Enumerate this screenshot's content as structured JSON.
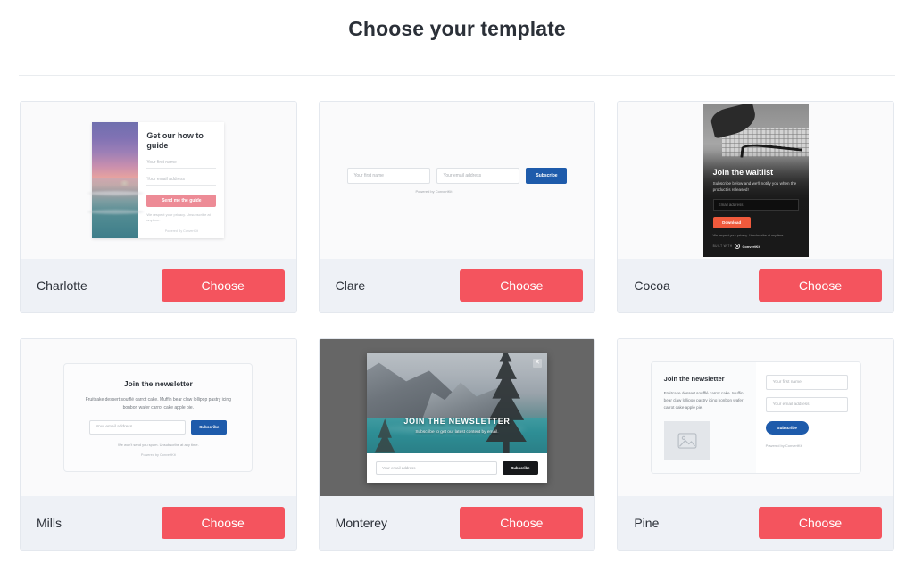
{
  "header": {
    "title": "Choose your template"
  },
  "common": {
    "choose_label": "Choose",
    "powered_by": "Powered by ConvertKit",
    "powered_by_cap": "Powered By ConvertKit",
    "built_with": "BUILT WITH",
    "convertkit": "ConvertKit",
    "placeholder_first_name": "Your first name",
    "placeholder_email": "Your email address",
    "subscribe_label": "Subscribe",
    "close_icon": "✕"
  },
  "colors": {
    "choose_button": "#f4545e",
    "footer_band": "#eef1f6",
    "preview_bg": "#fafafb",
    "card_border": "#e4e8ee",
    "blue_button": "#1e5bab",
    "orange_button": "#f05a3c",
    "pink_button": "#ed8b96",
    "dark_button": "#16181a",
    "title_text": "#2b3038"
  },
  "templates": [
    {
      "id": "charlotte",
      "name": "Charlotte",
      "preview": {
        "heading": "Get our how to guide",
        "first_name": "Your first name",
        "email": "Your email address",
        "button": "Send me the guide",
        "fine_print": "We respect your privacy. Unsubscribe at anytime.",
        "powered_by": "Powered By ConvertKit",
        "image_alt": "sunset-over-ocean-photo"
      }
    },
    {
      "id": "clare",
      "name": "Clare",
      "preview": {
        "first_name": "Your first name",
        "email": "Your email address",
        "button": "Subscribe",
        "powered_by": "Powered by ConvertKit"
      }
    },
    {
      "id": "cocoa",
      "name": "Cocoa",
      "preview": {
        "heading": "Join the waitlist",
        "subheading": "Subscribe below and we'll notify you when the product is released!",
        "email": "Email address",
        "button": "Download",
        "fine_print": "We respect your privacy. Unsubscribe at any time.",
        "built_with": "BUILT WITH",
        "convertkit": "ConvertKit",
        "image_alt": "grayscale-bicycle-city-photo"
      }
    },
    {
      "id": "mills",
      "name": "Mills",
      "preview": {
        "heading": "Join the newsletter",
        "body": "Fruitcake dessert soufflé carrot cake. Muffin bear claw lollipop pastry icing bonbon wafer carrot cake apple pie.",
        "email": "Your email address",
        "button": "Subscribe",
        "fine_print": "We won't send you spam. Unsubscribe at any time.",
        "powered_by": "Powered by ConvertKit"
      }
    },
    {
      "id": "monterey",
      "name": "Monterey",
      "preview": {
        "heading": "JOIN THE NEWSLETTER",
        "subheading": "Subscribe to get our latest content by email.",
        "email": "Your email address",
        "button": "Subscribe",
        "close_icon": "✕",
        "image_alt": "mountain-lake-pine-photo"
      }
    },
    {
      "id": "pine",
      "name": "Pine",
      "preview": {
        "heading": "Join the newsletter",
        "body": "Fruitcake dessert soufflé carrot cake. Muffin bear claw lollipop pastry icing bonbon wafer carrot cake apple pie.",
        "first_name": "Your first name",
        "email": "Your email address",
        "button": "Subscribe",
        "powered_by": "Powered by ConvertKit",
        "image_placeholder_alt": "image-placeholder-icon"
      }
    }
  ]
}
